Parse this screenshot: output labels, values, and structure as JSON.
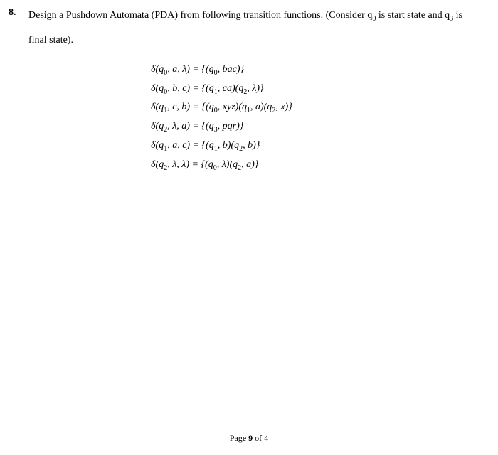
{
  "question": {
    "number": "8.",
    "text_line1": "Design a Pushdown Automata (PDA) from following transition functions. (Consider q",
    "start_sub": "0",
    "text_mid": " is start state and q",
    "final_sub": "3",
    "text_end": " is",
    "text_line2": "final state)."
  },
  "equations": [
    {
      "lhs_state_sub": "0",
      "lhs_sym": "a",
      "lhs_stack": "λ",
      "rhs": "{(q",
      "rhs_sub1": "0",
      "rhs_after1": ", bac)}"
    },
    {
      "lhs_state_sub": "0",
      "lhs_sym": "b",
      "lhs_stack": "c",
      "rhs": "{(q",
      "rhs_sub1": "1",
      "rhs_after1": ", ca)(q",
      "rhs_sub2": "2",
      "rhs_after2": ", λ)}"
    },
    {
      "lhs_state_sub": "1",
      "lhs_sym": "c",
      "lhs_stack": "b",
      "rhs": "{(q",
      "rhs_sub1": "0",
      "rhs_after1": ", xyz)(q",
      "rhs_sub2": "1",
      "rhs_after2": ", a)(q",
      "rhs_sub3": "2",
      "rhs_after3": ", x)}"
    },
    {
      "lhs_state_sub": "2",
      "lhs_sym": "λ",
      "lhs_stack": "a",
      "rhs": "{(q",
      "rhs_sub1": "3",
      "rhs_after1": ", pqr)}"
    },
    {
      "lhs_state_sub": "1",
      "lhs_sym": "a",
      "lhs_stack": "c",
      "rhs": "{(q",
      "rhs_sub1": "1",
      "rhs_after1": ", b)(q",
      "rhs_sub2": "2",
      "rhs_after2": ", b)}"
    },
    {
      "lhs_state_sub": "2",
      "lhs_sym": "λ",
      "lhs_stack": "λ",
      "rhs": "{(q",
      "rhs_sub1": "0",
      "rhs_after1": ", λ)(q",
      "rhs_sub2": "2",
      "rhs_after2": ", a)}"
    }
  ],
  "footer": {
    "page_label": "Page ",
    "page_num": "9",
    "of_label": " of ",
    "total": "4"
  }
}
